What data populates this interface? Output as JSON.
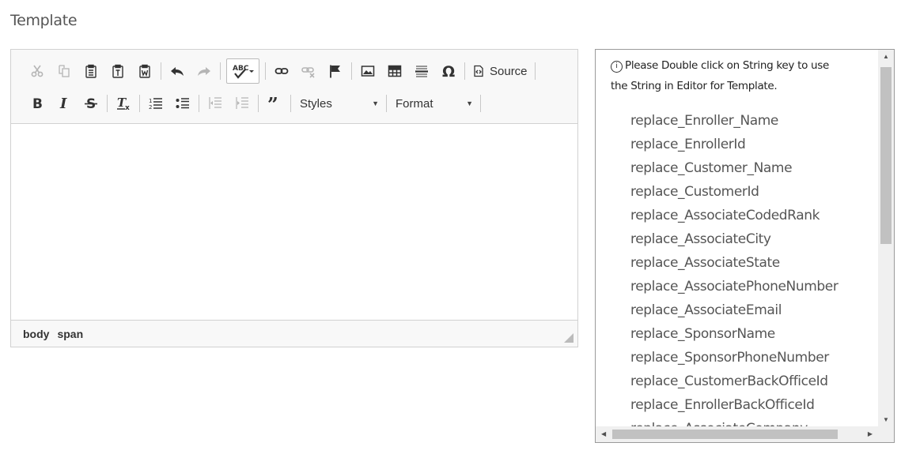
{
  "page": {
    "title": "Template"
  },
  "toolbar": {
    "source_label": "Source",
    "styles_label": "Styles",
    "format_label": "Format"
  },
  "statusbar": {
    "path": [
      "body",
      "span"
    ]
  },
  "keys_panel": {
    "instruction": "Please Double click on String key to use the String in Editor for Template.",
    "keys": [
      "replace_Enroller_Name",
      "replace_EnrollerId",
      "replace_Customer_Name",
      "replace_CustomerId",
      "replace_AssociateCodedRank",
      "replace_AssociateCity",
      "replace_AssociateState",
      "replace_AssociatePhoneNumber",
      "replace_AssociateEmail",
      "replace_SponsorName",
      "replace_SponsorPhoneNumber",
      "replace_CustomerBackOfficeId",
      "replace_EnrollerBackOfficeId",
      "replace_AssociateCompany"
    ]
  },
  "colors": {
    "toolbar_bg": "#f8f8f8",
    "border": "#d1d1d1",
    "icon": "#333333",
    "icon_disabled": "#b5b5b5"
  }
}
